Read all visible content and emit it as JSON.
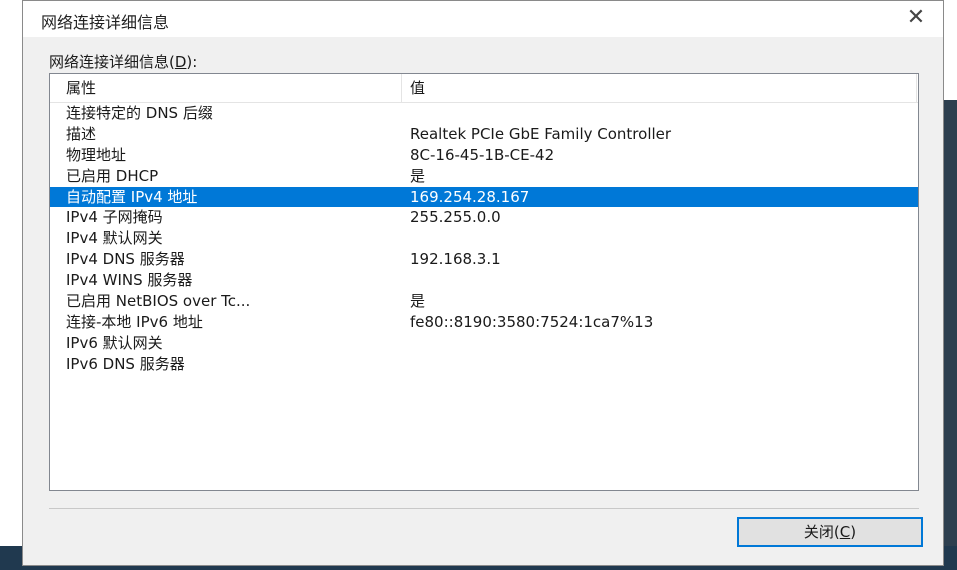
{
  "dialog": {
    "title": "网络连接详细信息",
    "close_glyph": "✕"
  },
  "details": {
    "label_prefix": "网络连接详细信息(",
    "label_key": "D",
    "label_suffix": "):",
    "columns": [
      "属性",
      "值"
    ],
    "selected_index": 4,
    "rows": [
      {
        "property": "连接特定的 DNS 后缀",
        "value": ""
      },
      {
        "property": "描述",
        "value": "Realtek PCIe GbE Family Controller"
      },
      {
        "property": "物理地址",
        "value": "8C-16-45-1B-CE-42"
      },
      {
        "property": "已启用 DHCP",
        "value": "是"
      },
      {
        "property": "自动配置 IPv4 地址",
        "value": "169.254.28.167"
      },
      {
        "property": "IPv4 子网掩码",
        "value": "255.255.0.0"
      },
      {
        "property": "IPv4 默认网关",
        "value": ""
      },
      {
        "property": "IPv4 DNS 服务器",
        "value": "192.168.3.1"
      },
      {
        "property": "IPv4 WINS 服务器",
        "value": ""
      },
      {
        "property": "已启用 NetBIOS over Tc...",
        "value": "是"
      },
      {
        "property": "连接-本地 IPv6 地址",
        "value": "fe80::8190:3580:7524:1ca7%13"
      },
      {
        "property": "IPv6 默认网关",
        "value": ""
      },
      {
        "property": "IPv6 DNS 服务器",
        "value": ""
      }
    ]
  },
  "footer": {
    "close_label_prefix": "关闭(",
    "close_label_key": "C",
    "close_label_suffix": ")"
  },
  "colors": {
    "selection": "#0078d7",
    "dialog_bg": "#f0f0f0"
  }
}
